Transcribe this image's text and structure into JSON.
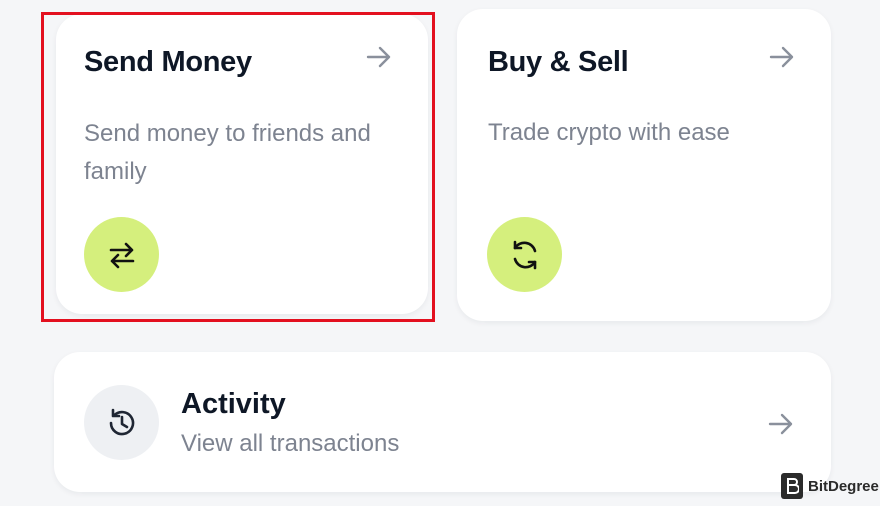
{
  "cards": {
    "send": {
      "title": "Send Money",
      "description": "Send money to friends and family",
      "arrow_icon": "arrow-right-icon",
      "action_icon": "swap-arrows-icon"
    },
    "buy_sell": {
      "title": "Buy & Sell",
      "description": "Trade crypto with ease",
      "arrow_icon": "arrow-right-icon",
      "action_icon": "refresh-icon"
    },
    "activity": {
      "title": "Activity",
      "description": "View all transactions",
      "arrow_icon": "arrow-right-icon",
      "leading_icon": "history-icon"
    }
  },
  "watermark": {
    "text": "BitDegree"
  },
  "colors": {
    "background": "#f5f6f8",
    "card": "#ffffff",
    "accent_green": "#d5ef7d",
    "highlight_border": "#e3101f",
    "title": "#0e1726",
    "muted_text": "#7d8390",
    "arrow": "#8a909c"
  }
}
